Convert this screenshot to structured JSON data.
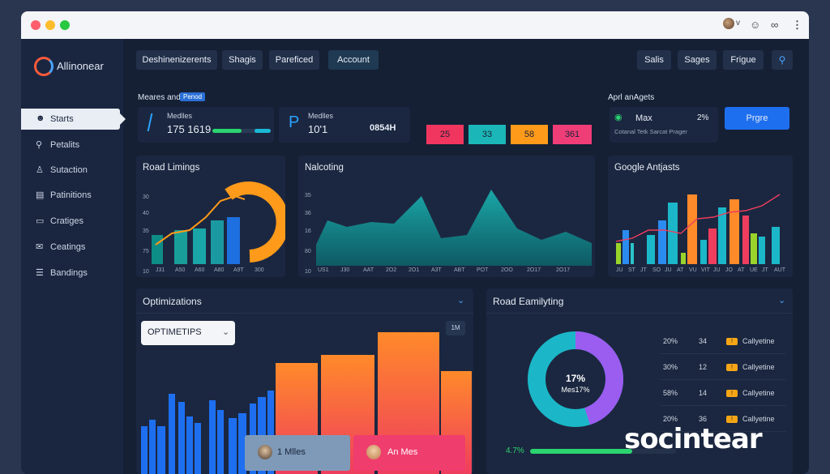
{
  "window": {
    "dot_colors": [
      "#ff5f6d",
      "#ffbd2e",
      "#28c840"
    ]
  },
  "brand": {
    "name": "Allinonear"
  },
  "sidebar": {
    "items": [
      {
        "label": "Starts",
        "icon": "user-icon",
        "active": true
      },
      {
        "label": "Petalits",
        "icon": "search-icon"
      },
      {
        "label": "Sutaction",
        "icon": "people-icon"
      },
      {
        "label": "Patinitions",
        "icon": "clipboard-icon"
      },
      {
        "label": "Cratiges",
        "icon": "card-icon"
      },
      {
        "label": "Ceatings",
        "icon": "chat-icon"
      },
      {
        "label": "Bandings",
        "icon": "list-icon"
      }
    ]
  },
  "toolbar": {
    "left": [
      "Deshinenizerents",
      "Shagis",
      "Pareficed",
      "Account"
    ],
    "right": [
      "Salis",
      "Sages",
      "Frigue"
    ],
    "search_icon": "search-icon"
  },
  "summary": {
    "section_label": "Meares and",
    "section_badge": "Penod",
    "card1": {
      "title": "Medlles",
      "value": "175 1619",
      "progress": 0.5
    },
    "card2": {
      "title": "Medlles",
      "value": "10'1",
      "side_value": "0854H"
    },
    "pills": [
      {
        "label": "25",
        "color": "#f0365e"
      },
      {
        "label": "33",
        "color": "#1bb7b8"
      },
      {
        "label": "58",
        "color": "#ff9a1a"
      },
      {
        "label": "361",
        "color": "#ef3d78"
      }
    ]
  },
  "april": {
    "title": "Aprl anAgets",
    "metric_label": "Max",
    "metric_value": "2%",
    "sub": "Cotanal  Tetk Sarcat  Prager",
    "button": "Prgre"
  },
  "road_limings": {
    "title": "Road Limings",
    "y_ticks": [
      "30",
      "40",
      "35",
      "75",
      "10"
    ],
    "x_ticks": [
      "J31",
      "A50",
      "A60",
      "A80",
      "A9T",
      "300"
    ]
  },
  "nalcoting": {
    "title": "Nalcoting",
    "y_ticks": [
      "35",
      "36",
      "16",
      "80",
      "10"
    ],
    "x_ticks": [
      "US1",
      "J30",
      "AAT",
      "2O2",
      "2O1",
      "A3T",
      "ABT",
      "POT",
      "2OO",
      "2O17",
      "2O17"
    ]
  },
  "google": {
    "title": "Google Antjasts",
    "x_ticks": [
      "JU",
      "ST",
      "JT",
      "SO",
      "JU",
      "AT",
      "VU",
      "VIT",
      "JU",
      "JO",
      "AT",
      "UE",
      "JT",
      "AUT"
    ]
  },
  "optimizations": {
    "title": "Optimizations",
    "dropdown": "OPTIMETIPS",
    "tag": "1M",
    "chip1": "1 Mlles",
    "chip2": "An Mes"
  },
  "road_emailyting": {
    "title": "Road Eamilyting",
    "donut_center": "17%",
    "donut_sub": "Mes17%",
    "donut_share": 0.45,
    "rows": [
      {
        "pct": "20%",
        "num": "34",
        "label": "Callyetine"
      },
      {
        "pct": "30%",
        "num": "12",
        "label": "Callyetine"
      },
      {
        "pct": "58%",
        "num": "14",
        "label": "Callyetine"
      },
      {
        "pct": "20%",
        "num": "36",
        "label": "Callyetine"
      }
    ],
    "progress_label": "4.7%",
    "progress": 0.7
  },
  "watermark": "socintear"
}
